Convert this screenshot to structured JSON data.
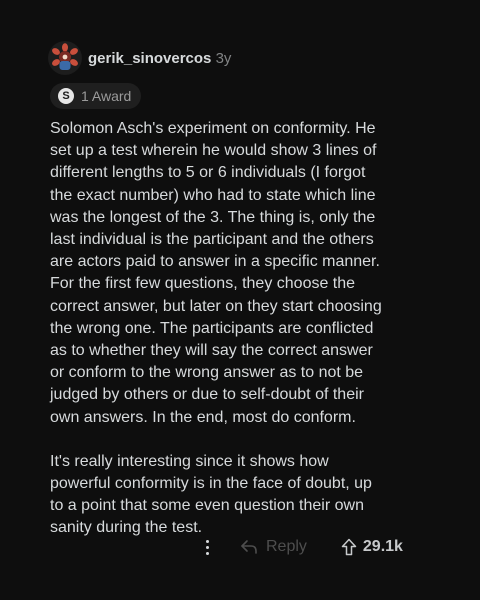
{
  "comment": {
    "username": "gerik_sinovercos",
    "age": "3y",
    "award_count_label": "1 Award",
    "award_icon": "S",
    "paragraphs": [
      "Solomon Asch's experiment on conformity. He\nset up a test wherein he would show 3 lines of\ndifferent lengths to 5 or 6 individuals (I forgot\nthe exact number) who had to state which line\nwas the longest of the 3. The thing is, only the\nlast individual is the participant and the others\nare actors paid to answer in a specific manner.\nFor the first few questions, they choose the\ncorrect answer, but later on they start choosing\nthe wrong one. The participants are conflicted\nas to whether they will say the correct answer\nor conform to the wrong answer as to not be\njudged by others or due to self-doubt of their\nown answers. In the end, most do conform.",
      "It's really interesting since it shows how\npowerful conformity is in the face of doubt, up\nto a point that some even question their own\nsanity during the test."
    ]
  },
  "actions": {
    "more_icon": "more-vertical-icon",
    "reply_label": "Reply",
    "upvote_count": "29.1k"
  }
}
